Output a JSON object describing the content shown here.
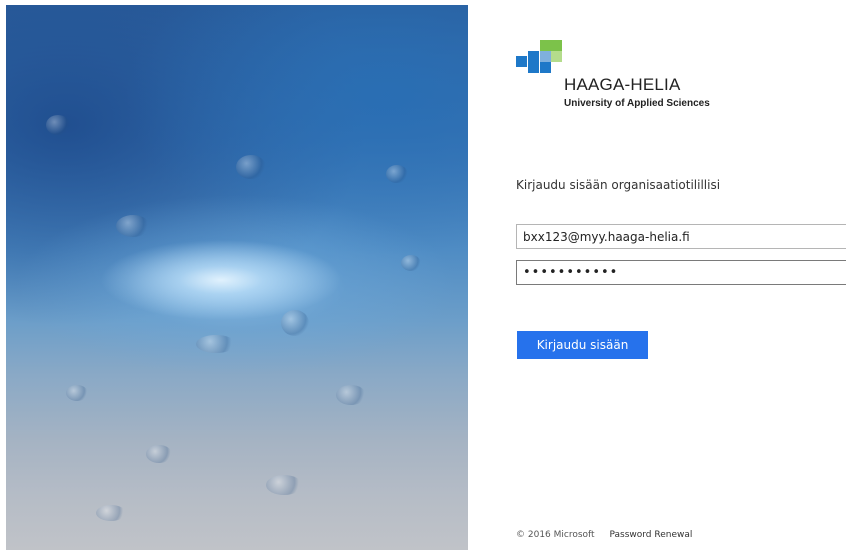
{
  "branding": {
    "logo_icon": "haaga-helia-squares-logo",
    "name": "HAAGA-HELIA",
    "subtitle": "University of Applied Sciences",
    "colors": {
      "blue": "#1e78c8",
      "light_blue": "#7fb0dd",
      "green": "#7cc24a",
      "light_green": "#b4dc8c"
    }
  },
  "login": {
    "prompt": "Kirjaudu sisään organisaatiotilillisi",
    "email_value": "bxx123@myy.haaga-helia.fi",
    "password_value": "•••••••••••",
    "submit_label": "Kirjaudu sisään"
  },
  "footer": {
    "copyright": "© 2016 Microsoft",
    "password_renewal_link": "Password Renewal"
  },
  "colors": {
    "button": "#2672ec"
  }
}
